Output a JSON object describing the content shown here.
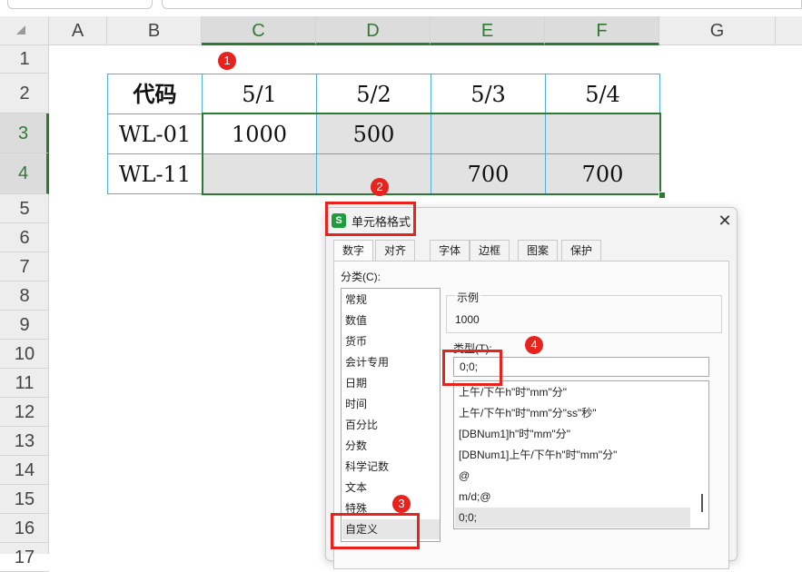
{
  "columns": [
    "A",
    "B",
    "C",
    "D",
    "E",
    "F",
    "G"
  ],
  "rows": [
    "1",
    "2",
    "3",
    "4",
    "5",
    "6",
    "7",
    "8",
    "9",
    "10",
    "11",
    "12",
    "13",
    "14",
    "15",
    "16",
    "17"
  ],
  "table": {
    "header": [
      "代码",
      "5/1",
      "5/2",
      "5/3",
      "5/4"
    ],
    "row1": [
      "WL-01",
      "1000",
      "500",
      "",
      ""
    ],
    "row2": [
      "WL-11",
      "",
      "",
      "700",
      "700"
    ]
  },
  "badges": [
    "1",
    "2",
    "3",
    "4"
  ],
  "dialog": {
    "title": "单元格格式",
    "app_icon": "S",
    "close": "✕",
    "tabs": [
      "数字",
      "对齐",
      "字体",
      "边框",
      "图案",
      "保护"
    ],
    "category_label": "分类(C):",
    "categories": [
      "常规",
      "数值",
      "货币",
      "会计专用",
      "日期",
      "时间",
      "百分比",
      "分数",
      "科学记数",
      "文本",
      "特殊",
      "自定义"
    ],
    "sample_label": "示例",
    "sample_value": "1000",
    "type_label": "类型(T):",
    "type_value": "0;0;",
    "formats": [
      "上午/下午h\"时\"mm\"分\"",
      "上午/下午h\"时\"mm\"分\"ss\"秒\"",
      "[DBNum1]h\"时\"mm\"分\"",
      "[DBNum1]上午/下午h\"时\"mm\"分\"",
      "@",
      "m/d;@",
      "0;0;"
    ]
  },
  "colors": {
    "selection": "#2f7a32",
    "cell_border": "#4fb0e0",
    "annotation": "#e8231e",
    "app_icon": "#1f9d3e"
  }
}
